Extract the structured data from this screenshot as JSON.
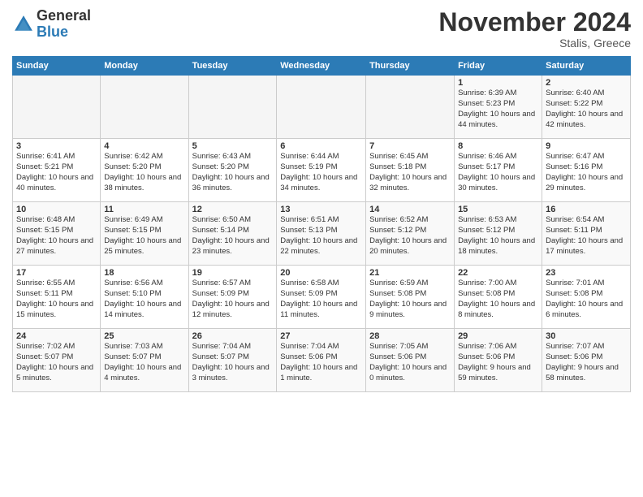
{
  "header": {
    "logo_general": "General",
    "logo_blue": "Blue",
    "month_title": "November 2024",
    "location": "Stalis, Greece"
  },
  "weekdays": [
    "Sunday",
    "Monday",
    "Tuesday",
    "Wednesday",
    "Thursday",
    "Friday",
    "Saturday"
  ],
  "weeks": [
    [
      {
        "day": "",
        "info": ""
      },
      {
        "day": "",
        "info": ""
      },
      {
        "day": "",
        "info": ""
      },
      {
        "day": "",
        "info": ""
      },
      {
        "day": "",
        "info": ""
      },
      {
        "day": "1",
        "info": "Sunrise: 6:39 AM\nSunset: 5:23 PM\nDaylight: 10 hours and 44 minutes."
      },
      {
        "day": "2",
        "info": "Sunrise: 6:40 AM\nSunset: 5:22 PM\nDaylight: 10 hours and 42 minutes."
      }
    ],
    [
      {
        "day": "3",
        "info": "Sunrise: 6:41 AM\nSunset: 5:21 PM\nDaylight: 10 hours and 40 minutes."
      },
      {
        "day": "4",
        "info": "Sunrise: 6:42 AM\nSunset: 5:20 PM\nDaylight: 10 hours and 38 minutes."
      },
      {
        "day": "5",
        "info": "Sunrise: 6:43 AM\nSunset: 5:20 PM\nDaylight: 10 hours and 36 minutes."
      },
      {
        "day": "6",
        "info": "Sunrise: 6:44 AM\nSunset: 5:19 PM\nDaylight: 10 hours and 34 minutes."
      },
      {
        "day": "7",
        "info": "Sunrise: 6:45 AM\nSunset: 5:18 PM\nDaylight: 10 hours and 32 minutes."
      },
      {
        "day": "8",
        "info": "Sunrise: 6:46 AM\nSunset: 5:17 PM\nDaylight: 10 hours and 30 minutes."
      },
      {
        "day": "9",
        "info": "Sunrise: 6:47 AM\nSunset: 5:16 PM\nDaylight: 10 hours and 29 minutes."
      }
    ],
    [
      {
        "day": "10",
        "info": "Sunrise: 6:48 AM\nSunset: 5:15 PM\nDaylight: 10 hours and 27 minutes."
      },
      {
        "day": "11",
        "info": "Sunrise: 6:49 AM\nSunset: 5:15 PM\nDaylight: 10 hours and 25 minutes."
      },
      {
        "day": "12",
        "info": "Sunrise: 6:50 AM\nSunset: 5:14 PM\nDaylight: 10 hours and 23 minutes."
      },
      {
        "day": "13",
        "info": "Sunrise: 6:51 AM\nSunset: 5:13 PM\nDaylight: 10 hours and 22 minutes."
      },
      {
        "day": "14",
        "info": "Sunrise: 6:52 AM\nSunset: 5:12 PM\nDaylight: 10 hours and 20 minutes."
      },
      {
        "day": "15",
        "info": "Sunrise: 6:53 AM\nSunset: 5:12 PM\nDaylight: 10 hours and 18 minutes."
      },
      {
        "day": "16",
        "info": "Sunrise: 6:54 AM\nSunset: 5:11 PM\nDaylight: 10 hours and 17 minutes."
      }
    ],
    [
      {
        "day": "17",
        "info": "Sunrise: 6:55 AM\nSunset: 5:11 PM\nDaylight: 10 hours and 15 minutes."
      },
      {
        "day": "18",
        "info": "Sunrise: 6:56 AM\nSunset: 5:10 PM\nDaylight: 10 hours and 14 minutes."
      },
      {
        "day": "19",
        "info": "Sunrise: 6:57 AM\nSunset: 5:09 PM\nDaylight: 10 hours and 12 minutes."
      },
      {
        "day": "20",
        "info": "Sunrise: 6:58 AM\nSunset: 5:09 PM\nDaylight: 10 hours and 11 minutes."
      },
      {
        "day": "21",
        "info": "Sunrise: 6:59 AM\nSunset: 5:08 PM\nDaylight: 10 hours and 9 minutes."
      },
      {
        "day": "22",
        "info": "Sunrise: 7:00 AM\nSunset: 5:08 PM\nDaylight: 10 hours and 8 minutes."
      },
      {
        "day": "23",
        "info": "Sunrise: 7:01 AM\nSunset: 5:08 PM\nDaylight: 10 hours and 6 minutes."
      }
    ],
    [
      {
        "day": "24",
        "info": "Sunrise: 7:02 AM\nSunset: 5:07 PM\nDaylight: 10 hours and 5 minutes."
      },
      {
        "day": "25",
        "info": "Sunrise: 7:03 AM\nSunset: 5:07 PM\nDaylight: 10 hours and 4 minutes."
      },
      {
        "day": "26",
        "info": "Sunrise: 7:04 AM\nSunset: 5:07 PM\nDaylight: 10 hours and 3 minutes."
      },
      {
        "day": "27",
        "info": "Sunrise: 7:04 AM\nSunset: 5:06 PM\nDaylight: 10 hours and 1 minute."
      },
      {
        "day": "28",
        "info": "Sunrise: 7:05 AM\nSunset: 5:06 PM\nDaylight: 10 hours and 0 minutes."
      },
      {
        "day": "29",
        "info": "Sunrise: 7:06 AM\nSunset: 5:06 PM\nDaylight: 9 hours and 59 minutes."
      },
      {
        "day": "30",
        "info": "Sunrise: 7:07 AM\nSunset: 5:06 PM\nDaylight: 9 hours and 58 minutes."
      }
    ]
  ]
}
